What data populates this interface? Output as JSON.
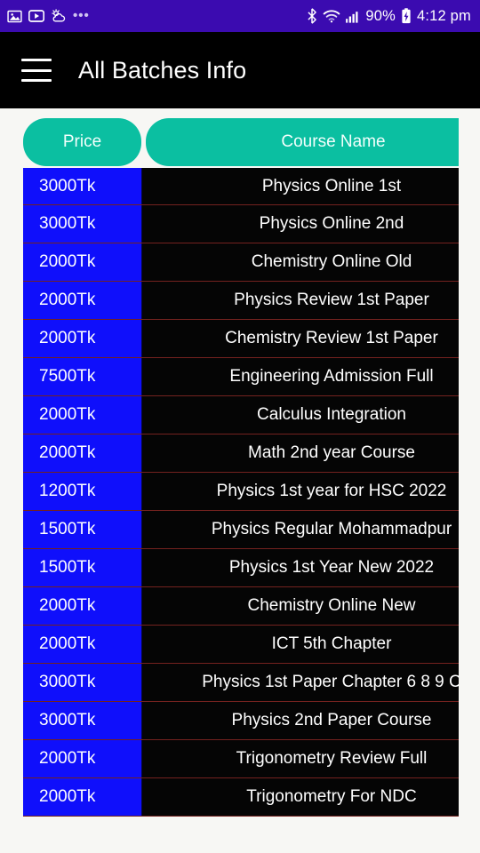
{
  "status_bar": {
    "background_color": "#3b0bb0",
    "left_icons": [
      {
        "name": "photo-icon",
        "glyph": "❑"
      },
      {
        "name": "video-player-icon",
        "glyph": "▶"
      },
      {
        "name": "weather-icon",
        "glyph": "☀"
      }
    ],
    "overflow_dots": "•••",
    "right_icons": [
      {
        "name": "bluetooth-icon",
        "glyph": "ᛦ"
      },
      {
        "name": "wifi-icon",
        "glyph": "◠"
      },
      {
        "name": "cellular-signal-icon",
        "glyph": "▂▄▆"
      }
    ],
    "battery_percent": "90%",
    "battery_charging_glyph": "⚡",
    "clock": "4:12 pm"
  },
  "app_bar": {
    "menu_icon": "hamburger-menu-icon",
    "title": "All Batches Info",
    "background_color": "#000000",
    "title_color": "#ffffff"
  },
  "table": {
    "accent_color": "#0bbfa1",
    "price_cell_color": "#0f0ffb",
    "course_cell_color": "#050505",
    "row_divider_color": "#74221f",
    "columns": [
      "Price",
      "Course Name"
    ],
    "row_count": 17,
    "rows": [
      {
        "price": "3000Tk",
        "course": "Physics Online 1st"
      },
      {
        "price": "3000Tk",
        "course": "Physics Online 2nd"
      },
      {
        "price": "2000Tk",
        "course": "Chemistry Online Old"
      },
      {
        "price": "2000Tk",
        "course": "Physics Review 1st Paper"
      },
      {
        "price": "2000Tk",
        "course": "Chemistry Review 1st Paper"
      },
      {
        "price": "7500Tk",
        "course": "Engineering Admission Full"
      },
      {
        "price": "2000Tk",
        "course": "Calculus Integration"
      },
      {
        "price": "2000Tk",
        "course": "Math 2nd year Course"
      },
      {
        "price": "1200Tk",
        "course": "Physics 1st year for HSC 2022"
      },
      {
        "price": "1500Tk",
        "course": "Physics Regular Mohammadpur"
      },
      {
        "price": "1500Tk",
        "course": "Physics 1st Year New 2022"
      },
      {
        "price": "2000Tk",
        "course": "Chemistry Online New"
      },
      {
        "price": "2000Tk",
        "course": "ICT 5th Chapter"
      },
      {
        "price": "3000Tk",
        "course": "Physics 1st Paper Chapter 6 8 9 C"
      },
      {
        "price": "3000Tk",
        "course": "Physics 2nd Paper Course"
      },
      {
        "price": "2000Tk",
        "course": "Trigonometry Review Full"
      },
      {
        "price": "2000Tk",
        "course": "Trigonometry For NDC"
      }
    ]
  }
}
